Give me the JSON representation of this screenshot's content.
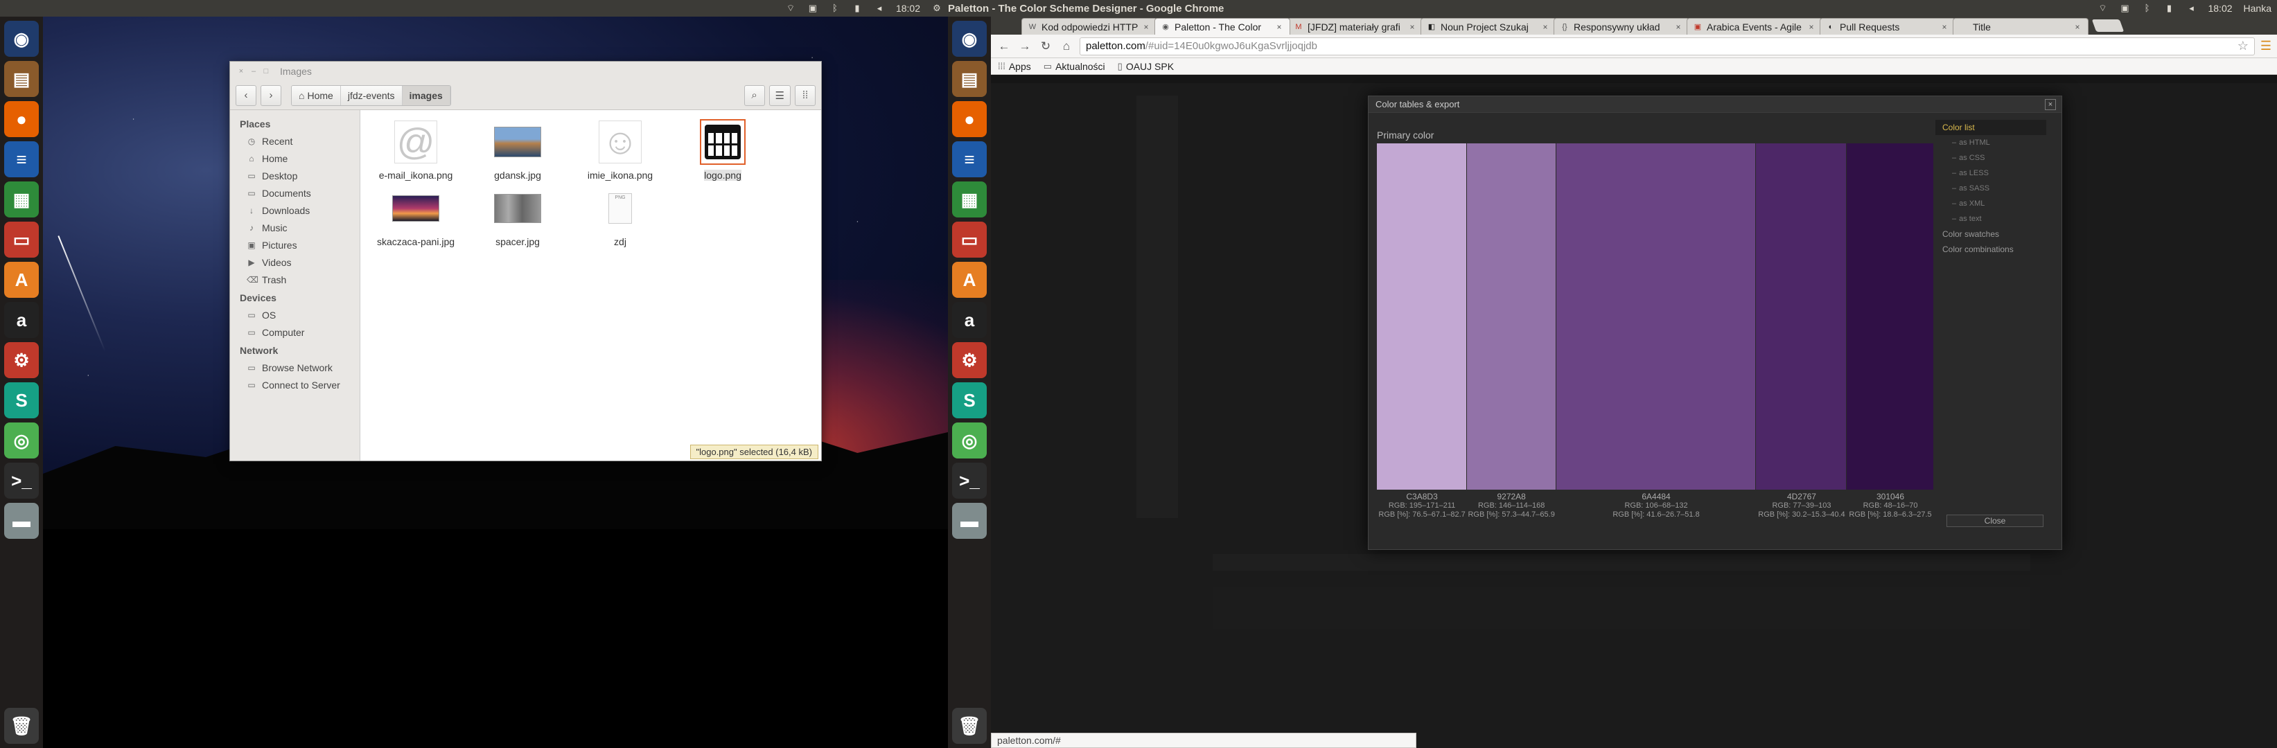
{
  "left_screen": {
    "panel": {
      "time": "18:02",
      "status_icons": [
        "wifi-icon",
        "keyboard-icon",
        "bluetooth-icon",
        "battery-icon",
        "volume-icon",
        "gear-icon"
      ]
    },
    "launcher": [
      {
        "name": "dash-home",
        "glyph": "◉",
        "bg": "#1f3b6b"
      },
      {
        "name": "files",
        "glyph": "▤",
        "bg": "#8a5a2b"
      },
      {
        "name": "firefox",
        "glyph": "●",
        "bg": "#e66000"
      },
      {
        "name": "writer",
        "glyph": "≡",
        "bg": "#1e5aa8"
      },
      {
        "name": "calc",
        "glyph": "▦",
        "bg": "#2e8b3a"
      },
      {
        "name": "impress",
        "glyph": "▭",
        "bg": "#c0392b"
      },
      {
        "name": "software-center",
        "glyph": "A",
        "bg": "#e67e22"
      },
      {
        "name": "amazon",
        "glyph": "a",
        "bg": "#222222"
      },
      {
        "name": "settings",
        "glyph": "⚙",
        "bg": "#c0392b"
      },
      {
        "name": "app-green",
        "glyph": "S",
        "bg": "#16a085"
      },
      {
        "name": "chrome",
        "glyph": "◎",
        "bg": "#4caf50"
      },
      {
        "name": "terminal",
        "glyph": ">_",
        "bg": "#2c2c2c"
      },
      {
        "name": "drive",
        "glyph": "▬",
        "bg": "#7f8c8d"
      }
    ]
  },
  "nautilus": {
    "title": "Images",
    "path": [
      "Home",
      "jfdz-events",
      "images"
    ],
    "places_heading": "Places",
    "places": [
      {
        "label": "Recent",
        "icon": "clock-icon",
        "glyph": "◷"
      },
      {
        "label": "Home",
        "icon": "home-icon",
        "glyph": "⌂"
      },
      {
        "label": "Desktop",
        "icon": "folder-icon",
        "glyph": "▭"
      },
      {
        "label": "Documents",
        "icon": "folder-icon",
        "glyph": "▭"
      },
      {
        "label": "Downloads",
        "icon": "download-icon",
        "glyph": "↓"
      },
      {
        "label": "Music",
        "icon": "music-icon",
        "glyph": "♪"
      },
      {
        "label": "Pictures",
        "icon": "picture-icon",
        "glyph": "▣"
      },
      {
        "label": "Videos",
        "icon": "video-icon",
        "glyph": "▶"
      },
      {
        "label": "Trash",
        "icon": "trash-icon",
        "glyph": "⌫"
      }
    ],
    "devices_heading": "Devices",
    "devices": [
      {
        "label": "OS",
        "icon": "drive-icon",
        "glyph": "▭"
      },
      {
        "label": "Computer",
        "icon": "computer-icon",
        "glyph": "▭"
      }
    ],
    "network_heading": "Network",
    "network": [
      {
        "label": "Browse Network",
        "icon": "network-icon",
        "glyph": "▭"
      },
      {
        "label": "Connect to Server",
        "icon": "server-icon",
        "glyph": "▭"
      }
    ],
    "files": [
      {
        "name": "e-mail_ikona.png",
        "kind": "at"
      },
      {
        "name": "gdansk.jpg",
        "kind": "photo-city"
      },
      {
        "name": "imie_ikona.png",
        "kind": "smiley"
      },
      {
        "name": "logo.png",
        "kind": "calendar",
        "selected": true
      },
      {
        "name": "skaczaca-pani.jpg",
        "kind": "photo-sunset"
      },
      {
        "name": "spacer.jpg",
        "kind": "photo-street"
      },
      {
        "name": "zdj",
        "kind": "doc"
      }
    ],
    "status": "\"logo.png\" selected  (16,4 kB)"
  },
  "right_screen": {
    "panel": {
      "window_title": "Paletton - The Color Scheme Designer - Google Chrome",
      "time": "18:02",
      "user": "Hanka"
    },
    "tabs": [
      {
        "title": "Kod odpowiedzi HTTP",
        "fav": "W",
        "fav_color": "#555"
      },
      {
        "title": "Paletton - The Color",
        "fav": "◉",
        "fav_color": "#555",
        "active": true
      },
      {
        "title": "[JFDZ] materiały grafi",
        "fav": "M",
        "fav_color": "#c0392b"
      },
      {
        "title": "Noun Project Szukaj",
        "fav": "◧",
        "fav_color": "#222"
      },
      {
        "title": "Responsywny układ",
        "fav": "{}",
        "fav_color": "#555"
      },
      {
        "title": "Arabica Events - Agile",
        "fav": "▣",
        "fav_color": "#c0392b"
      },
      {
        "title": "Pull Requests",
        "fav": "◐",
        "fav_color": "#222"
      },
      {
        "title": "Title",
        "fav": "",
        "fav_color": "#555"
      }
    ],
    "url_host": "paletton.com",
    "url_path": "/#uid=14E0u0kgwoJ6uKgaSvrljjoqjdb",
    "bookmarks": [
      {
        "label": "Apps",
        "glyph": "⁞⁞⁞"
      },
      {
        "label": "Aktualności",
        "glyph": "▭"
      },
      {
        "label": "OAUJ SPK",
        "glyph": "▯"
      }
    ],
    "dialog": {
      "title": "Color tables & export",
      "primary_label": "Primary color",
      "swatches": [
        {
          "hex": "C3A8D3",
          "rgb": "RGB: 195–171–211",
          "rgbp": "RGB [%]: 76.5–67.1–82.7",
          "color": "#C3A8D3",
          "flex": 62
        },
        {
          "hex": "9272A8",
          "rgb": "RGB: 146–114–168",
          "rgbp": "RGB [%]: 57.3–44.7–65.9",
          "color": "#9272A8",
          "flex": 61
        },
        {
          "hex": "6A4484",
          "rgb": "RGB: 106–68–132",
          "rgbp": "RGB [%]: 41.6–26.7–51.8",
          "color": "#6A4484",
          "flex": 138
        },
        {
          "hex": "4D2767",
          "rgb": "RGB: 77–39–103",
          "rgbp": "RGB [%]: 30.2–15.3–40.4",
          "color": "#4D2767",
          "flex": 62
        },
        {
          "hex": "301046",
          "rgb": "RGB: 48–16–70",
          "rgbp": "RGB [%]: 18.8–6.3–27.5",
          "color": "#301046",
          "flex": 60
        }
      ],
      "menu": [
        {
          "label": "Color list",
          "active": true
        },
        {
          "label": "as HTML",
          "sub": true
        },
        {
          "label": "as CSS",
          "sub": true
        },
        {
          "label": "as LESS",
          "sub": true
        },
        {
          "label": "as SASS",
          "sub": true
        },
        {
          "label": "as XML",
          "sub": true
        },
        {
          "label": "as text",
          "sub": true
        },
        {
          "label": "Color swatches"
        },
        {
          "label": "Color combinations"
        }
      ],
      "close_label": "Close"
    },
    "status_url": "paletton.com/#"
  }
}
